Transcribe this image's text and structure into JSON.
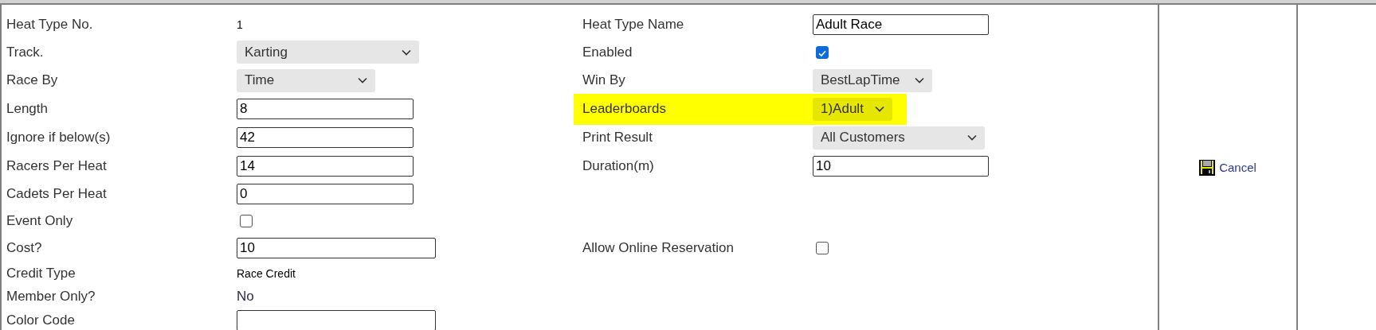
{
  "rows": [
    {
      "left": {
        "label": "Heat Type No.",
        "kind": "note",
        "value": "1"
      },
      "right": {
        "label": "Heat Type Name",
        "kind": "input",
        "value": "Adult Race",
        "highlighted": false
      }
    },
    {
      "left": {
        "label": "Track.",
        "kind": "select",
        "value": "Karting"
      },
      "right": {
        "label": "Enabled",
        "kind": "checkbox",
        "checked": true,
        "highlighted": false
      }
    },
    {
      "left": {
        "label": "Race By",
        "kind": "select",
        "value": "Time"
      },
      "right": {
        "label": "Win By",
        "kind": "select",
        "value": "BestLapTime",
        "highlighted": false
      }
    },
    {
      "left": {
        "label": "Length",
        "kind": "input",
        "value": "8"
      },
      "right": {
        "label": "Leaderboards",
        "kind": "select",
        "value": "1)Adult",
        "highlighted": true
      }
    },
    {
      "left": {
        "label": "Ignore if below(s)",
        "kind": "input",
        "value": "42"
      },
      "right": {
        "label": "Print Result",
        "kind": "select",
        "value": "All Customers",
        "highlighted": false
      }
    },
    {
      "left": {
        "label": "Racers Per Heat",
        "kind": "input",
        "value": "14"
      },
      "right": {
        "label": "Duration(m)",
        "kind": "input",
        "value": "10",
        "highlighted": false
      }
    },
    {
      "left": {
        "label": "Cadets Per Heat",
        "kind": "input",
        "value": "0"
      }
    },
    {
      "left": {
        "label": "Event Only",
        "kind": "checkbox",
        "checked": false
      }
    },
    {
      "left": {
        "label": "Cost?",
        "kind": "input",
        "value": "10"
      },
      "right": {
        "label": "Allow Online Reservation",
        "kind": "checkbox",
        "checked": false,
        "highlighted": false
      }
    },
    {
      "left": {
        "label": "Credit Type",
        "kind": "note",
        "value": "Race Credit"
      }
    },
    {
      "left": {
        "label": "Member Only?",
        "kind": "text",
        "value": "No"
      }
    },
    {
      "left": {
        "label": "Color Code",
        "kind": "input"
      }
    }
  ],
  "actions": {
    "cancel": "Cancel"
  }
}
